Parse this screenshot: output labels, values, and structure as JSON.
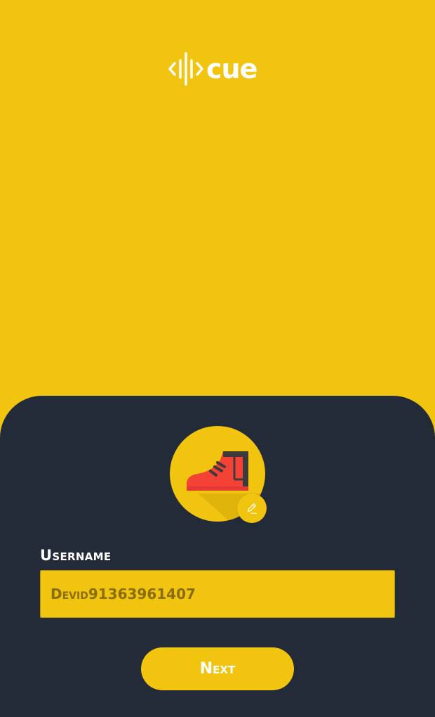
{
  "brand": {
    "name": "cue",
    "logo_icon": "soundwave-brackets-icon",
    "color_primary": "#F1C40F",
    "color_panel": "#232A38",
    "color_text_light": "#FFFFFF"
  },
  "profile": {
    "avatar_icon": "sneaker-icon",
    "avatar_color": "#F44336",
    "edit_icon": "pencil-icon"
  },
  "form": {
    "username_label": "Username",
    "username_placeholder": "Devid91363961407",
    "username_value": "",
    "next_label": "Next"
  }
}
